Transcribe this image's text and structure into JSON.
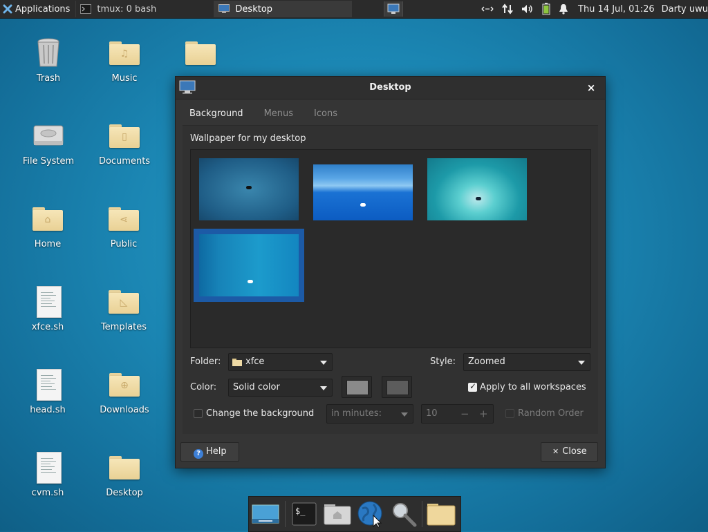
{
  "panel": {
    "applications_label": "Applications",
    "tasks": [
      {
        "label": "tmux: 0 bash",
        "icon": "terminal-icon"
      },
      {
        "label": "Desktop",
        "icon": "desktop-settings-icon"
      }
    ],
    "clock": "Thu 14 Jul, 01:26",
    "user": "Darty uwu",
    "tray_icons": [
      "network-icon",
      "transfer-icon",
      "volume-icon",
      "battery-icon",
      "notification-bell-icon"
    ]
  },
  "desktop_icons": [
    {
      "label": "Trash",
      "icon": "trash-icon"
    },
    {
      "label": "Music",
      "icon": "music-folder-icon"
    },
    {
      "label": "File System",
      "icon": "hard-drive-icon"
    },
    {
      "label": "Documents",
      "icon": "documents-folder-icon"
    },
    {
      "label": "Home",
      "icon": "home-folder-icon"
    },
    {
      "label": "Public",
      "icon": "public-folder-icon"
    },
    {
      "label": "xfce.sh",
      "icon": "script-file-icon"
    },
    {
      "label": "Templates",
      "icon": "templates-folder-icon"
    },
    {
      "label": "head.sh",
      "icon": "script-file-icon"
    },
    {
      "label": "Downloads",
      "icon": "downloads-folder-icon"
    },
    {
      "label": "cvm.sh",
      "icon": "script-file-icon"
    },
    {
      "label": "Desktop",
      "icon": "desktop-folder-icon"
    }
  ],
  "dialog": {
    "title": "Desktop",
    "close_glyph": "×",
    "tabs": [
      {
        "label": "Background",
        "active": true
      },
      {
        "label": "Menus",
        "active": false
      },
      {
        "label": "Icons",
        "active": false
      }
    ],
    "wallpaper_label": "Wallpaper for my desktop",
    "wallpapers": [
      {
        "name": "wallpaper-1",
        "selected": false
      },
      {
        "name": "wallpaper-2",
        "selected": false
      },
      {
        "name": "wallpaper-3",
        "selected": false
      },
      {
        "name": "wallpaper-4",
        "selected": true
      }
    ],
    "folder_label": "Folder:",
    "folder_value": "xfce",
    "style_label": "Style:",
    "style_value": "Zoomed",
    "color_label": "Color:",
    "color_value": "Solid color",
    "color1": "#8a8a8a",
    "color2": "#5c5c5c",
    "apply_all_label": "Apply to all workspaces",
    "apply_all_checked": true,
    "change_bg_label": "Change the background",
    "change_bg_checked": false,
    "interval_unit": "in minutes:",
    "interval_value": "10",
    "spin_minus": "−",
    "spin_plus": "+",
    "random_order_label": "Random Order",
    "random_order_checked": false,
    "help_label": "Help",
    "help_glyph": "?",
    "close_label": "Close",
    "close_button_glyph": "✕"
  },
  "dock": {
    "items": [
      "show-desktop-icon",
      "terminal-icon",
      "home-folder-icon",
      "web-browser-icon",
      "search-icon",
      "file-manager-icon"
    ],
    "terminal_glyph": "$_"
  }
}
